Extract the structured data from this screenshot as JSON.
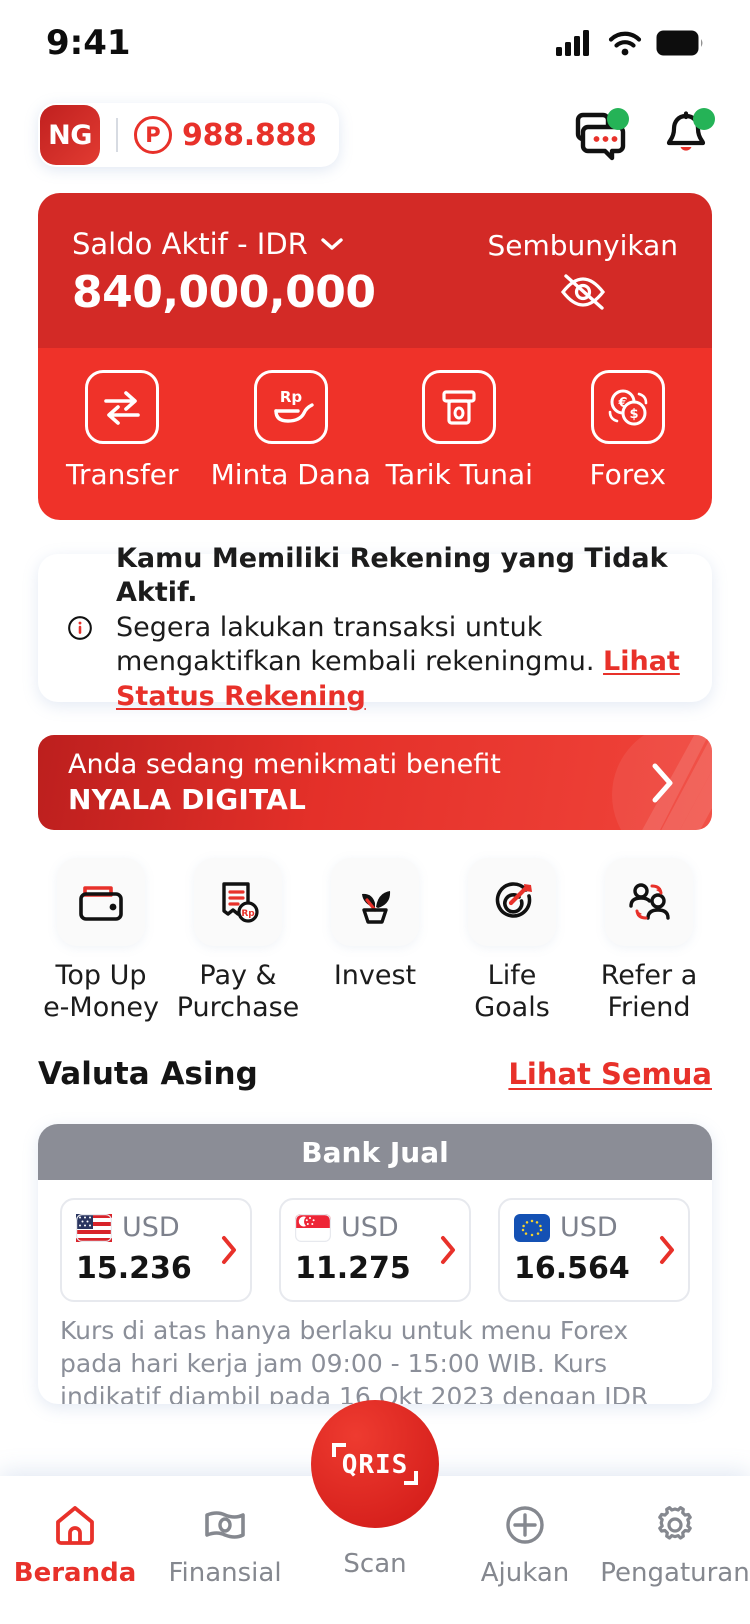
{
  "status_bar": {
    "time": "9:41",
    "icons": [
      "cellular-signal-icon",
      "wifi-icon",
      "battery-icon"
    ]
  },
  "header": {
    "avatar_initials": "NG",
    "points_symbol": "℘",
    "points_value": "988.888",
    "chat_icon": "chat-bubbles-icon",
    "bell_icon": "notification-bell-icon"
  },
  "balance": {
    "label": "Saldo Aktif - IDR",
    "amount": "840,000,000",
    "hide_label": "Sembunyikan",
    "hide_icon": "eye-off-icon",
    "chevron_icon": "chevron-down-icon",
    "quick_actions": [
      {
        "label": "Transfer",
        "icon": "transfer-arrows-icon"
      },
      {
        "label": "Minta Dana",
        "icon": "request-funds-rp-hand-icon"
      },
      {
        "label": "Tarik Tunai",
        "icon": "atm-cash-withdrawal-icon"
      },
      {
        "label": "Forex",
        "icon": "forex-exchange-coins-icon"
      }
    ]
  },
  "alert": {
    "icon": "info-circle-icon",
    "title": "Kamu Memiliki Rekening yang Tidak Aktif.",
    "body": "Segera lakukan transaksi untuk mengaktifkan kembali rekeningmu. ",
    "link": "Lihat Status Rekening"
  },
  "benefit_banner": {
    "line1": "Anda sedang menikmati benefit",
    "line2": "NYALA DIGITAL",
    "arrow_icon": "chevron-right-icon"
  },
  "menu": [
    {
      "label_line1": "Top Up",
      "label_line2": "e-Money",
      "icon": "wallet-icon"
    },
    {
      "label_line1": "Pay &",
      "label_line2": "Purchase",
      "icon": "bill-receipt-rp-icon"
    },
    {
      "label_line1": "Invest",
      "label_line2": "",
      "icon": "plant-sprout-icon"
    },
    {
      "label_line1": "Life Goals",
      "label_line2": "",
      "icon": "target-dart-icon"
    },
    {
      "label_line1": "Refer a",
      "label_line2": "Friend",
      "icon": "refer-friend-people-icon"
    }
  ],
  "valuta_asing": {
    "title": "Valuta Asing",
    "see_all": "Lihat Semua",
    "table_header": "Bank Jual",
    "rates": [
      {
        "flag": "us-flag-icon",
        "code": "USD",
        "rate": "15.236",
        "arrow_icon": "chevron-right-icon"
      },
      {
        "flag": "sg-flag-icon",
        "code": "USD",
        "rate": "11.275",
        "arrow_icon": "chevron-right-icon"
      },
      {
        "flag": "eu-flag-icon",
        "code": "USD",
        "rate": "16.564",
        "arrow_icon": "chevron-right-icon"
      }
    ],
    "note": "Kurs di atas hanya berlaku untuk menu Forex pada hari kerja jam 09:00 - 15:00 WIB. Kurs indikatif diambil pada 16 Okt 2023 dengan IDR sebagai mata uang pokok."
  },
  "bottom_nav": {
    "items": [
      {
        "label": "Beranda",
        "icon": "home-icon",
        "active": true
      },
      {
        "label": "Finansial",
        "icon": "banknote-icon",
        "active": false
      },
      {
        "label": "Scan",
        "icon": "qris-logo-icon",
        "active": false
      },
      {
        "label": "Ajukan",
        "icon": "plus-circle-icon",
        "active": false
      },
      {
        "label": "Pengaturan",
        "icon": "gear-icon",
        "active": false
      }
    ],
    "scan_logo_text": "QRIS"
  },
  "colors": {
    "brand_red": "#e8312a",
    "card_red_dark": "#d32a26",
    "card_red_light": "#ef3229",
    "fx_header_gray": "#8b8d96",
    "badge_green": "#25b357"
  }
}
